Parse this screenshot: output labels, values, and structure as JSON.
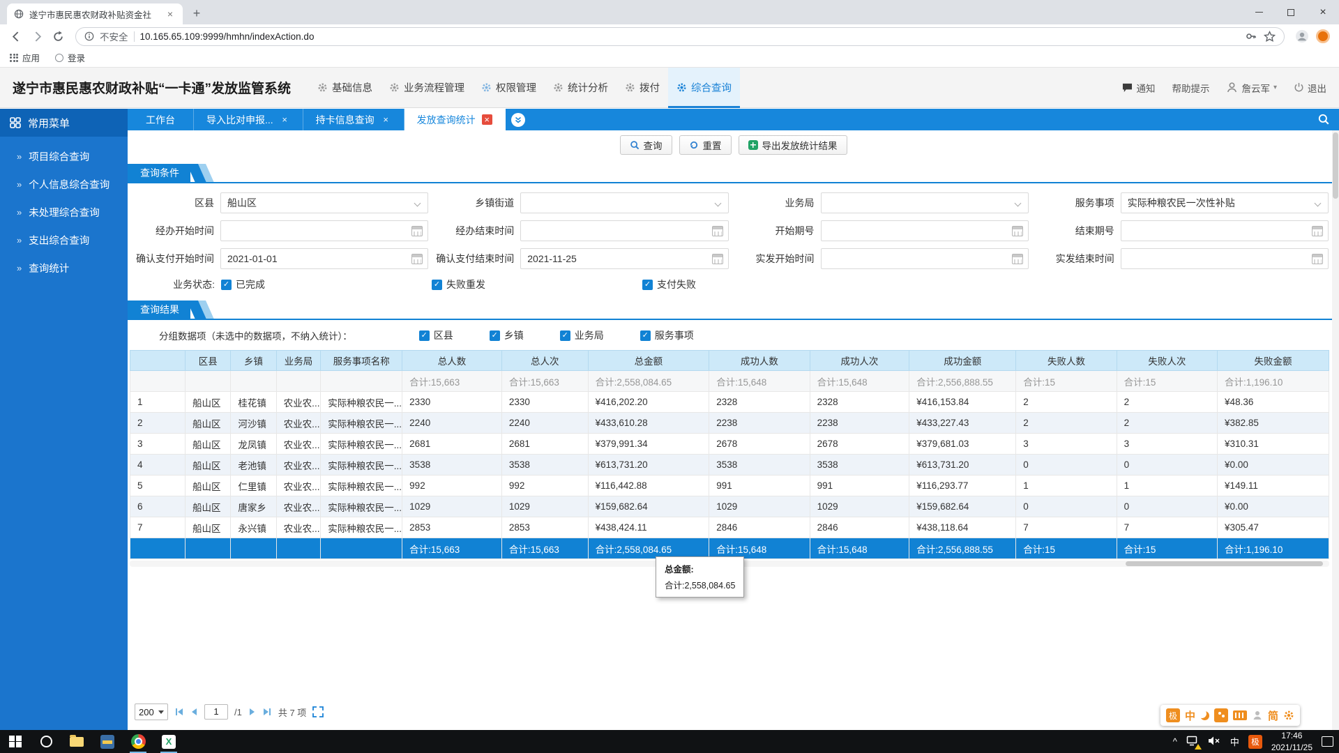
{
  "icons": {
    "close": "×",
    "plus": "+",
    "chevron": "»",
    "check": "✓",
    "caret_down": "▾",
    "caret_up": "^",
    "slash_total": "/1"
  },
  "browser": {
    "tab_title": "遂宁市惠民惠农财政补贴资金社",
    "security": "不安全",
    "url": "10.165.65.109:9999/hmhn/indexAction.do",
    "bookmark_apps": "应用",
    "bookmark_login": "登录"
  },
  "header": {
    "title": "遂宁市惠民惠农财政补贴“一卡通”发放监管系统",
    "nav": [
      {
        "label": "基础信息",
        "active": false
      },
      {
        "label": "业务流程管理",
        "active": false
      },
      {
        "label": "权限管理",
        "active": false,
        "blue_icon": true
      },
      {
        "label": "统计分析",
        "active": false
      },
      {
        "label": "拨付",
        "active": false
      },
      {
        "label": "综合查询",
        "active": true
      }
    ],
    "notice": "通知",
    "help": "帮助提示",
    "user": "詹云军",
    "logout": "退出"
  },
  "sidebar": {
    "title": "常用菜单",
    "items": [
      "项目综合查询",
      "个人信息综合查询",
      "未处理综合查询",
      "支出综合查询",
      "查询统计"
    ]
  },
  "tabs": [
    {
      "label": "工作台",
      "closable": false,
      "active": false
    },
    {
      "label": "导入比对申报...",
      "closable": true,
      "active": false
    },
    {
      "label": "持卡信息查询",
      "closable": true,
      "active": false
    },
    {
      "label": "发放查询统计",
      "closable": true,
      "active": true
    }
  ],
  "toolbar": {
    "query": "查询",
    "reset": "重置",
    "export": "导出发放统计结果"
  },
  "query_panel": {
    "title": "查询条件",
    "row1": [
      {
        "label": "区县",
        "value": "船山区",
        "type": "select"
      },
      {
        "label": "乡镇街道",
        "value": "",
        "type": "select"
      },
      {
        "label": "业务局",
        "value": "",
        "type": "select"
      },
      {
        "label": "服务事项",
        "value": "实际种粮农民一次性补贴",
        "type": "select"
      }
    ],
    "row2": [
      {
        "label": "经办开始时间",
        "value": "",
        "type": "date"
      },
      {
        "label": "经办结束时间",
        "value": "",
        "type": "date"
      },
      {
        "label": "开始期号",
        "value": "",
        "type": "date"
      },
      {
        "label": "结束期号",
        "value": "",
        "type": "date"
      }
    ],
    "row3": [
      {
        "label": "确认支付开始时间",
        "value": "2021-01-01",
        "type": "date"
      },
      {
        "label": "确认支付结束时间",
        "value": "2021-11-25",
        "type": "date"
      },
      {
        "label": "实发开始时间",
        "value": "",
        "type": "date"
      },
      {
        "label": "实发结束时间",
        "value": "",
        "type": "date"
      }
    ],
    "status_label": "业务状态:",
    "status_options": [
      {
        "label": "已完成",
        "checked": true
      },
      {
        "label": "失败重发",
        "checked": true
      },
      {
        "label": "支付失败",
        "checked": true
      }
    ]
  },
  "result_panel": {
    "title": "查询结果",
    "group_label": "分组数据项（未选中的数据项，不纳入统计）：",
    "group_options": [
      {
        "label": "区县",
        "checked": true
      },
      {
        "label": "乡镇",
        "checked": true
      },
      {
        "label": "业务局",
        "checked": true
      },
      {
        "label": "服务事项",
        "checked": true
      }
    ],
    "table": {
      "headers": [
        "",
        "区县",
        "乡镇",
        "业务局",
        "服务事项名称",
        "总人数",
        "总人次",
        "总金额",
        "成功人数",
        "成功人次",
        "成功金额",
        "失败人数",
        "失败人次",
        "失败金额"
      ],
      "subtotal": [
        "",
        "",
        "",
        "",
        "",
        "合计:15,663",
        "合计:15,663",
        "合计:2,558,084.65",
        "合计:15,648",
        "合计:15,648",
        "合计:2,556,888.55",
        "合计:15",
        "合计:15",
        "合计:1,196.10"
      ],
      "rows": [
        [
          "1",
          "船山区",
          "桂花镇",
          "农业农...",
          "实际种粮农民一...",
          "2330",
          "2330",
          "¥416,202.20",
          "2328",
          "2328",
          "¥416,153.84",
          "2",
          "2",
          "¥48.36"
        ],
        [
          "2",
          "船山区",
          "河沙镇",
          "农业农...",
          "实际种粮农民一...",
          "2240",
          "2240",
          "¥433,610.28",
          "2238",
          "2238",
          "¥433,227.43",
          "2",
          "2",
          "¥382.85"
        ],
        [
          "3",
          "船山区",
          "龙凤镇",
          "农业农...",
          "实际种粮农民一...",
          "2681",
          "2681",
          "¥379,991.34",
          "2678",
          "2678",
          "¥379,681.03",
          "3",
          "3",
          "¥310.31"
        ],
        [
          "4",
          "船山区",
          "老池镇",
          "农业农...",
          "实际种粮农民一...",
          "3538",
          "3538",
          "¥613,731.20",
          "3538",
          "3538",
          "¥613,731.20",
          "0",
          "0",
          "¥0.00"
        ],
        [
          "5",
          "船山区",
          "仁里镇",
          "农业农...",
          "实际种粮农民一...",
          "992",
          "992",
          "¥116,442.88",
          "991",
          "991",
          "¥116,293.77",
          "1",
          "1",
          "¥149.11"
        ],
        [
          "6",
          "船山区",
          "唐家乡",
          "农业农...",
          "实际种粮农民一...",
          "1029",
          "1029",
          "¥159,682.64",
          "1029",
          "1029",
          "¥159,682.64",
          "0",
          "0",
          "¥0.00"
        ],
        [
          "7",
          "船山区",
          "永兴镇",
          "农业农...",
          "实际种粮农民一...",
          "2853",
          "2853",
          "¥438,424.11",
          "2846",
          "2846",
          "¥438,118.64",
          "7",
          "7",
          "¥305.47"
        ]
      ],
      "total": [
        "",
        "",
        "",
        "",
        "",
        "合计:15,663",
        "合计:15,663",
        "合计:2,558,084.65",
        "合计:15,648",
        "合计:15,648",
        "合计:2,556,888.55",
        "合计:15",
        "合计:15",
        "合计:1,196.10"
      ]
    },
    "tooltip": {
      "title": "总金额:",
      "value": "合计:2,558,084.65"
    }
  },
  "pagination": {
    "page_size": "200",
    "page": "1",
    "page_total": "/1",
    "items_total": "共 7 项"
  },
  "taskbar": {
    "ime_cn": "中",
    "ime_ji": "极",
    "time": "17:46",
    "date": "2021/11/25"
  },
  "ime_bar": {
    "ji": "极",
    "zhong": "中",
    "jian": "简"
  }
}
